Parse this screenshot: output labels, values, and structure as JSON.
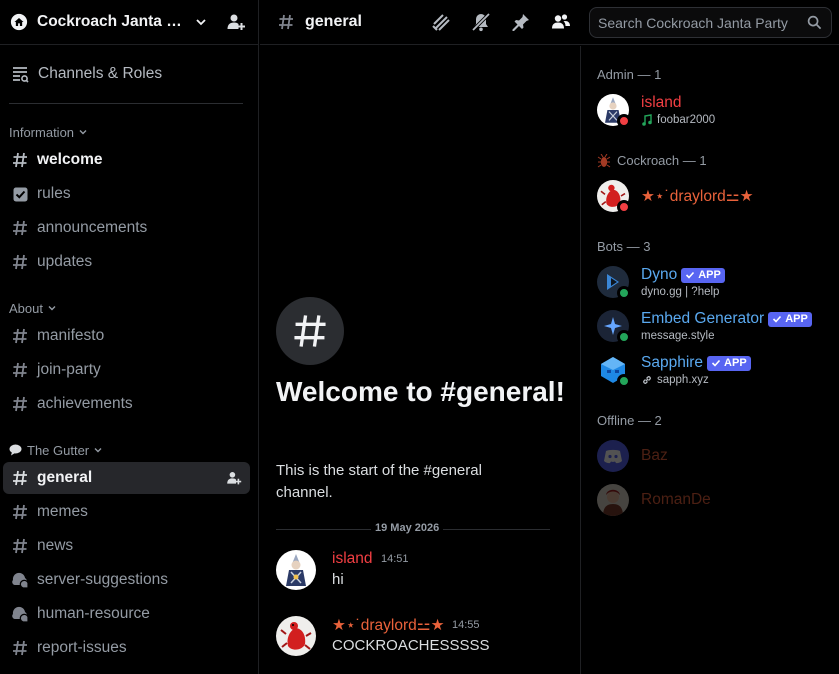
{
  "server": {
    "name": "Cockroach Janta Party"
  },
  "sidebar": {
    "channels_roles_label": "Channels & Roles",
    "categories": [
      {
        "label": "Information"
      },
      {
        "label": "About"
      },
      {
        "label": "The Gutter"
      }
    ],
    "channels": [
      {
        "label": "welcome"
      },
      {
        "label": "rules"
      },
      {
        "label": "announcements"
      },
      {
        "label": "updates"
      },
      {
        "label": "manifesto"
      },
      {
        "label": "join-party"
      },
      {
        "label": "achievements"
      },
      {
        "label": "general"
      },
      {
        "label": "memes"
      },
      {
        "label": "news"
      },
      {
        "label": "server-suggestions"
      },
      {
        "label": "human-resource"
      },
      {
        "label": "report-issues"
      }
    ]
  },
  "topbar": {
    "channel_name": "general",
    "search_placeholder": "Search Cockroach Janta Party"
  },
  "chat": {
    "welcome_title": "Welcome to #general!",
    "welcome_subtitle": "This is the start of the #general channel.",
    "date_divider": "19 May 2026",
    "messages": [
      {
        "author": "island",
        "time": "14:51",
        "text": "hi",
        "color": "#f23f43"
      },
      {
        "author": "★⋆˙draylord⚍★",
        "time": "14:55",
        "text": "COCKROACHESSSSS",
        "color": "#e9623b"
      }
    ]
  },
  "members": {
    "groups": [
      {
        "label": "Admin — 1"
      },
      {
        "label": "Cockroach — 1"
      },
      {
        "label": "Bots — 3"
      },
      {
        "label": "Offline — 2"
      }
    ],
    "list": [
      {
        "name": "island",
        "sub": "foobar2000",
        "color": "#f23f43"
      },
      {
        "name": "★⋆˙draylord⚍★",
        "sub": "",
        "color": "#e9623b"
      },
      {
        "name": "Dyno",
        "sub": "dyno.gg | ?help",
        "badge": "APP",
        "color": "#5aa9f0"
      },
      {
        "name": "Embed Generator",
        "sub": "message.style",
        "badge": "APP",
        "color": "#5aa9f0"
      },
      {
        "name": "Sapphire",
        "sub": "sapph.xyz",
        "badge": "APP",
        "color": "#5aa9f0"
      },
      {
        "name": "Baz",
        "sub": "",
        "color": "#e9623b"
      },
      {
        "name": "RomanDe",
        "sub": "",
        "color": "#e9623b"
      }
    ]
  },
  "colors": {
    "online": "#23a55a",
    "dnd": "#f23f43",
    "accent": "#5865f2"
  }
}
